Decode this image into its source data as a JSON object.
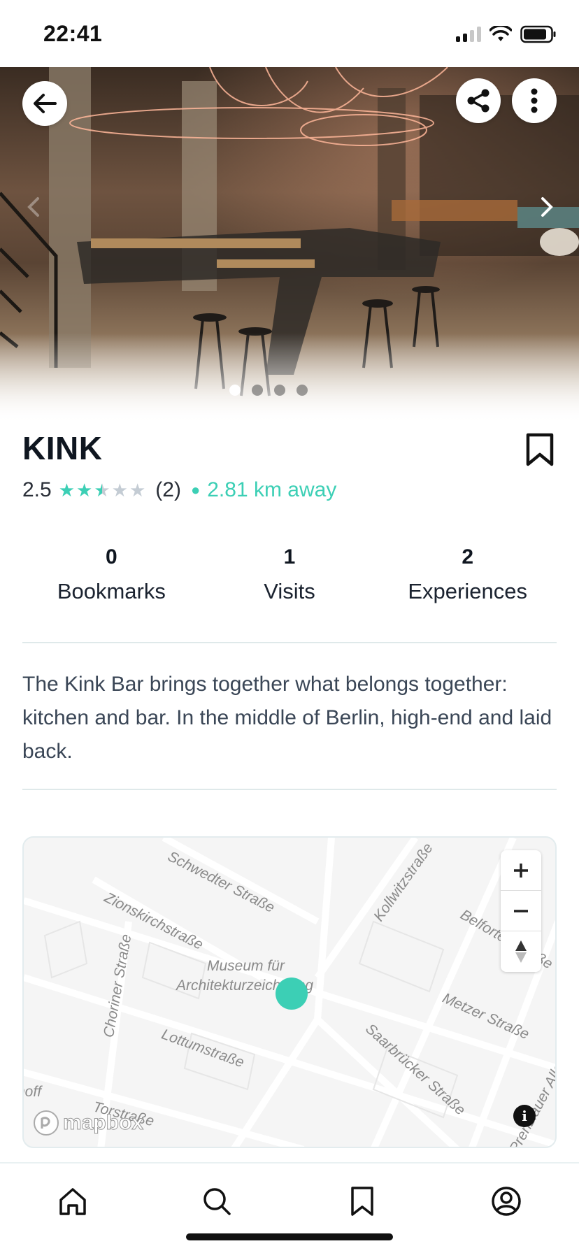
{
  "status_bar": {
    "time": "22:41"
  },
  "hero": {
    "icons": [
      "back-arrow-icon",
      "share-icon",
      "more-vertical-icon",
      "chevron-left-icon",
      "chevron-right-icon"
    ],
    "carousel": {
      "count": 4,
      "active_index": 0
    }
  },
  "venue": {
    "name": "KINK",
    "rating": "2.5",
    "rating_value": 2.5,
    "rating_max": 5,
    "review_count": "(2)",
    "distance": "2.81 km away"
  },
  "stats": [
    {
      "value": "0",
      "label": "Bookmarks"
    },
    {
      "value": "1",
      "label": "Visits"
    },
    {
      "value": "2",
      "label": "Experiences"
    }
  ],
  "description": "The Kink Bar brings together what belongs together: kitchen and bar. In the middle of Berlin, high-end and laid back.",
  "map": {
    "labels": {
      "schwedter": "Schwedter Straße",
      "zionskirch": "Zionskirchstraße",
      "choriner": "Choriner Straße",
      "museum1": "Museum für",
      "museum2": "Architekturzeichnung",
      "lottum": "Lottumstraße",
      "kollwitz": "Kollwitzstraße",
      "belforter": "Belforter Straße",
      "metzer": "Metzer Straße",
      "saarbruecker": "Saarbrücker Straße",
      "hoff": "hoff",
      "tor": "Torstraße",
      "allee": "Prenzlauer Allee"
    },
    "attribution": "mapbox",
    "controls": [
      "plus-icon",
      "minus-icon",
      "compass-icon",
      "info-icon"
    ]
  },
  "colors": {
    "accent": "#3ccfb5",
    "text": "#0f1620",
    "divider": "#dfe9ea"
  },
  "bottom_nav": [
    "home-icon",
    "search-icon",
    "bookmark-icon",
    "profile-icon"
  ]
}
